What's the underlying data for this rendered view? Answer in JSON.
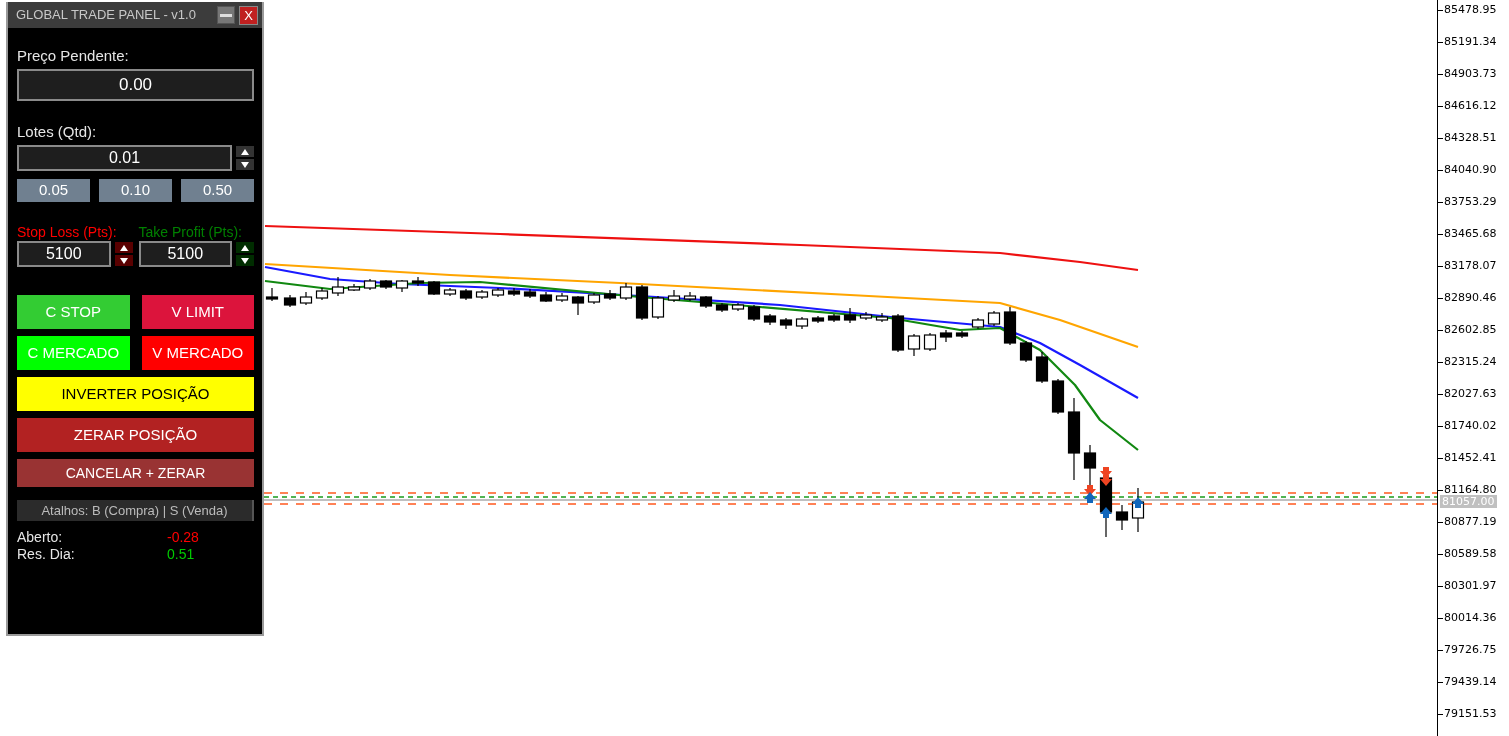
{
  "panel": {
    "title": "GLOBAL TRADE PANEL - v1.0",
    "close_label": "X",
    "pending_price": {
      "label": "Preço Pendente:",
      "value": "0.00"
    },
    "lots": {
      "label": "Lotes (Qtd):",
      "value": "0.01",
      "presets": [
        "0.05",
        "0.10",
        "0.50"
      ]
    },
    "risk_fields": [
      {
        "label": "Stop Loss (Pts):",
        "value": "5100",
        "color": "#ff0000"
      },
      {
        "label": "Take Profit (Pts):",
        "value": "5100",
        "color": "#008000"
      }
    ],
    "buttons": [
      {
        "label": "C STOP",
        "kind": "half",
        "color": "#33cc33"
      },
      {
        "label": "V LIMIT",
        "kind": "half",
        "color": "#dc143c"
      },
      {
        "label": "C MERCADO",
        "kind": "half",
        "color": "#00ff00"
      },
      {
        "label": "V MERCADO",
        "kind": "half",
        "color": "#ff0000"
      },
      {
        "label": "INVERTER POSIÇÃO",
        "kind": "full",
        "color": "#ffff00"
      },
      {
        "label": "ZERAR POSIÇÃO",
        "kind": "full",
        "color": "#b22222"
      },
      {
        "label": "CANCELAR + ZERAR",
        "kind": "small",
        "color": "#993333"
      }
    ],
    "shortcuts": "Atalhos: B (Compra) | S (Venda)",
    "stats": [
      {
        "label": "Aberto:",
        "value": "-0.28",
        "color": "#ff0000"
      },
      {
        "label": "Res. Dia:",
        "value": "0.51",
        "color": "#00cc00"
      }
    ]
  },
  "price_axis": {
    "labels": [
      "85478.95",
      "85191.34",
      "84903.73",
      "84616.12",
      "84328.51",
      "84040.90",
      "83753.29",
      "83465.68",
      "83178.07",
      "82890.46",
      "82602.85",
      "82315.24",
      "82027.63",
      "81740.02",
      "81452.41",
      "81164.80",
      "80877.19",
      "80589.58",
      "80301.97",
      "80014.36",
      "79726.75",
      "79439.14",
      "79151.53"
    ],
    "current_price": "81057.00"
  }
}
